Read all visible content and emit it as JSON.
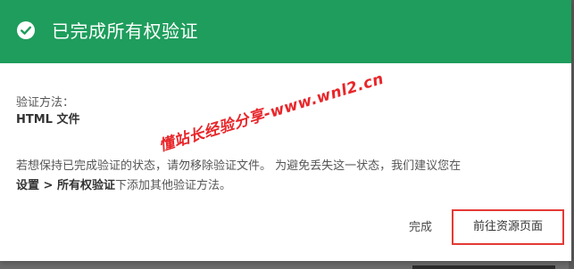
{
  "dialog": {
    "title": "已完成所有权验证",
    "method_label": "验证方法：",
    "method_value": "HTML 文件",
    "desc_line1": "若想保持已完成验证的状态，请勿移除验证文件。 为避免丢失这一状态，我们建议您在",
    "desc_bold": "设置 > 所有权验证",
    "desc_line2_rest": "下添加其他验证方法。",
    "done_label": "完成",
    "goto_label": "前往资源页面"
  },
  "watermark": {
    "text": "懂站长经验分享-www.wnl2.cn"
  },
  "colors": {
    "header_green": "#1e9d5c",
    "highlight_red": "#e53935"
  },
  "icons": {
    "header_icon": "check-circle-icon"
  }
}
